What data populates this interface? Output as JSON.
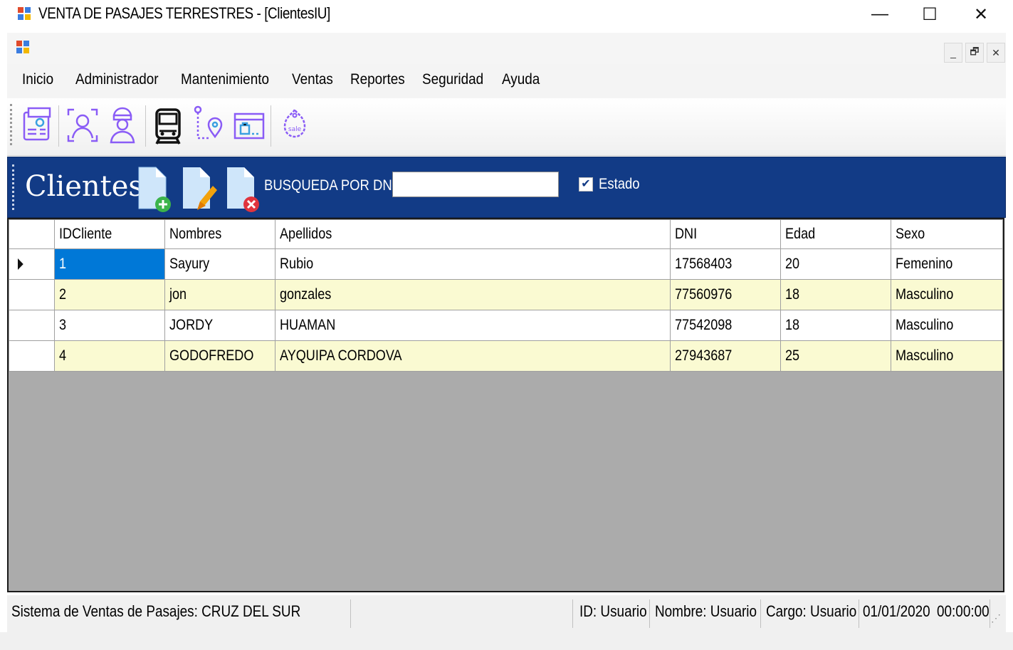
{
  "window": {
    "title": "VENTA DE PASAJES TERRESTRES - [ClientesIU]",
    "minimize_glyph": "—",
    "maximize_glyph": "☐",
    "close_glyph": "✕"
  },
  "mdi_controls": {
    "minimize": "_",
    "restore": "🗗",
    "close": "✕"
  },
  "menu": {
    "items": [
      "Inicio",
      "Administrador",
      "Mantenimiento",
      "Ventas",
      "Reportes",
      "Seguridad",
      "Ayuda"
    ]
  },
  "toolbar": {
    "icons": [
      "id-card-icon",
      "person-face-scan-icon",
      "woman-user-icon",
      "bus-icon",
      "route-pin-icon",
      "luggage-window-icon",
      "sale-tag-icon"
    ]
  },
  "header": {
    "title": "Clientes",
    "search_label": "BUSQUEDA POR DNI:",
    "search_value": "",
    "estado_label": "Estado",
    "estado_checked": true
  },
  "grid": {
    "columns": [
      "IDCliente",
      "Nombres",
      "Apellidos",
      "DNI",
      "Edad",
      "Sexo"
    ],
    "rows": [
      [
        "1",
        "Sayury",
        "Rubio",
        "17568403",
        "20",
        "Femenino"
      ],
      [
        "2",
        "jon",
        "gonzales",
        "77560976",
        "18",
        "Masculino"
      ],
      [
        "3",
        "JORDY",
        "HUAMAN",
        "77542098",
        "18",
        "Masculino"
      ],
      [
        "4",
        "GODOFREDO",
        "AYQUIPA CORDOVA",
        "27943687",
        "25",
        "Masculino"
      ]
    ]
  },
  "status": {
    "system": "Sistema de Ventas  de Pasajes: CRUZ DEL SUR",
    "id": "ID: Usuario",
    "nombre": "Nombre: Usuario",
    "cargo": "Cargo: Usuario",
    "date": "01/01/2020",
    "time": "00:00:00"
  },
  "colors": {
    "header_blue": "#123b86",
    "alt_row": "#fafad2",
    "selection": "#0078d7",
    "icon_purple": "#8a5cf6"
  }
}
